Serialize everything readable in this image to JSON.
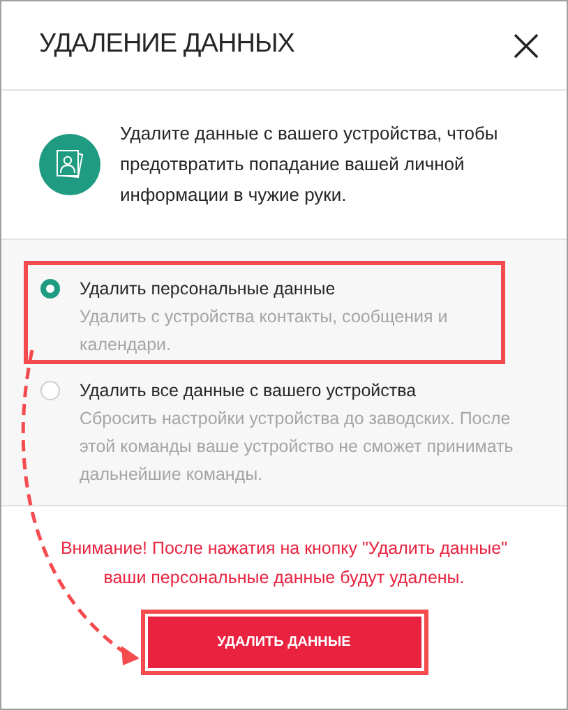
{
  "dialog": {
    "title": "УДАЛЕНИЕ ДАННЫХ",
    "info": "Удалите данные с вашего устройства, чтобы предотвратить попадание вашей личной информации в чужие руки."
  },
  "options": [
    {
      "title": "Удалить персональные данные",
      "description": "Удалить с устройства контакты, сообщения и календари.",
      "selected": true
    },
    {
      "title": "Удалить все данные с вашего устройства",
      "description": "Сбросить настройки устройства до заводских. После этой команды ваше устройство не сможет принимать дальнейшие команды.",
      "selected": false
    }
  ],
  "warning": "Внимание! После нажатия на кнопку \"Удалить данные\" ваши персональные данные будут удалены.",
  "button": "УДАЛИТЬ ДАННЫЕ"
}
